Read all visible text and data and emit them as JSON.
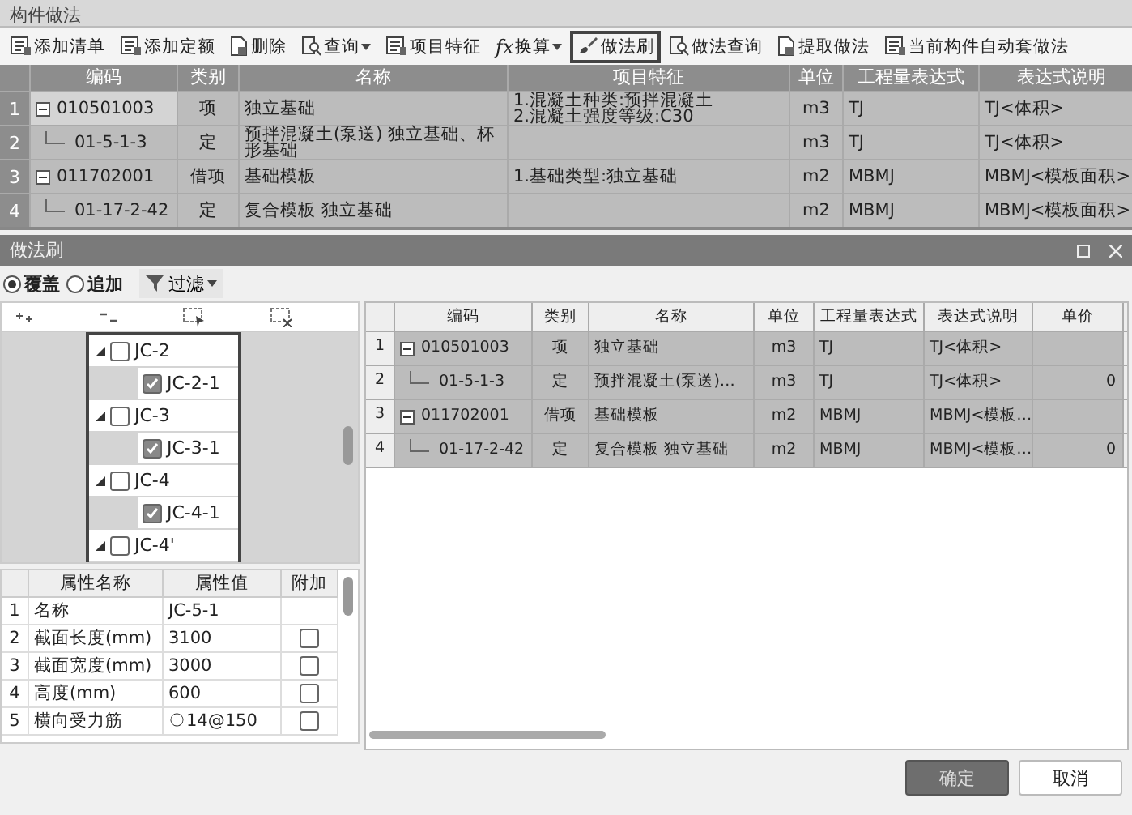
{
  "window": {
    "title": "构件做法"
  },
  "toolbar": [
    {
      "label": "添加清单",
      "kind": "list",
      "dropdown": false,
      "selected": false
    },
    {
      "label": "添加定额",
      "kind": "list",
      "dropdown": false,
      "selected": false
    },
    {
      "label": "删除",
      "kind": "doc",
      "dropdown": false,
      "selected": false
    },
    {
      "label": "查询",
      "kind": "search",
      "dropdown": true,
      "selected": false
    },
    {
      "label": "项目特征",
      "kind": "list",
      "dropdown": false,
      "selected": false
    },
    {
      "label": "换算",
      "kind": "formula",
      "glyph": "fx",
      "dropdown": true,
      "selected": false
    },
    {
      "label": "做法刷",
      "kind": "brush",
      "dropdown": false,
      "selected": true
    },
    {
      "label": "做法查询",
      "kind": "search",
      "dropdown": false,
      "selected": false
    },
    {
      "label": "提取做法",
      "kind": "doc",
      "dropdown": false,
      "selected": false
    },
    {
      "label": "当前构件自动套做法",
      "kind": "list",
      "dropdown": false,
      "selected": false
    }
  ],
  "top_table": {
    "columns": [
      "编码",
      "类别",
      "名称",
      "项目特征",
      "单位",
      "工程量表达式",
      "表达式说明"
    ],
    "rows": [
      {
        "num": "1",
        "kind": "parent",
        "expanded": true,
        "code": "010501003",
        "type": "项",
        "name": "独立基础",
        "feature": "1.混凝土种类:预拌混凝土\n2.混凝土强度等级:C30",
        "unit": "m3",
        "expr": "TJ",
        "desc": "TJ<体积>"
      },
      {
        "num": "2",
        "kind": "child",
        "code": "01-5-1-3",
        "type": "定",
        "name": "预拌混凝土(泵送) 独立基础、杯形基础",
        "feature": "",
        "unit": "m3",
        "expr": "TJ",
        "desc": "TJ<体积>"
      },
      {
        "num": "3",
        "kind": "parent",
        "expanded": true,
        "code": "011702001",
        "type": "借项",
        "name": "基础模板",
        "feature": "1.基础类型:独立基础",
        "unit": "m2",
        "expr": "MBMJ",
        "desc": "MBMJ<模板面积>"
      },
      {
        "num": "4",
        "kind": "child",
        "code": "01-17-2-42",
        "type": "定",
        "name": "复合模板 独立基础",
        "feature": "",
        "unit": "m2",
        "expr": "MBMJ",
        "desc": "MBMJ<模板面积>"
      }
    ]
  },
  "dialog": {
    "title": "做法刷",
    "modes": [
      {
        "label": "覆盖",
        "selected": true
      },
      {
        "label": "追加",
        "selected": false
      }
    ],
    "filter": {
      "label": "过滤"
    },
    "tree": [
      {
        "label": "JC-2",
        "expanded": true,
        "checked": false,
        "children": [
          {
            "label": "JC-2-1",
            "checked": true
          }
        ]
      },
      {
        "label": "JC-3",
        "expanded": true,
        "checked": false,
        "children": [
          {
            "label": "JC-3-1",
            "checked": true
          }
        ]
      },
      {
        "label": "JC-4",
        "expanded": true,
        "checked": false,
        "children": [
          {
            "label": "JC-4-1",
            "checked": true
          }
        ]
      },
      {
        "label": "JC-4'",
        "expanded": true,
        "checked": false
      }
    ],
    "properties": {
      "columns": [
        "属性名称",
        "属性值",
        "附加"
      ],
      "rows": [
        {
          "num": "1",
          "name": "名称",
          "value": "JC-5-1"
        },
        {
          "num": "2",
          "name": "截面长度(mm)",
          "value": "3100",
          "attached": false
        },
        {
          "num": "3",
          "name": "截面宽度(mm)",
          "value": "3000",
          "attached": false
        },
        {
          "num": "4",
          "name": "高度(mm)",
          "value": "600",
          "attached": false
        },
        {
          "num": "5",
          "name": "横向受力筋",
          "value": "⏀14@150",
          "attached": false
        }
      ]
    },
    "methods": {
      "columns": [
        "编码",
        "类别",
        "名称",
        "单位",
        "工程量表达式",
        "表达式说明",
        "单价"
      ],
      "rows": [
        {
          "num": "1",
          "kind": "parent",
          "expanded": true,
          "code": "010501003",
          "type": "项",
          "name": "独立基础",
          "unit": "m3",
          "expr": "TJ",
          "desc": "TJ<体积>",
          "price": ""
        },
        {
          "num": "2",
          "kind": "child",
          "code": "01-5-1-3",
          "type": "定",
          "name": "预拌混凝土(泵送)…",
          "unit": "m3",
          "expr": "TJ",
          "desc": "TJ<体积>",
          "price": "0"
        },
        {
          "num": "3",
          "kind": "parent",
          "expanded": true,
          "code": "011702001",
          "type": "借项",
          "name": "基础模板",
          "unit": "m2",
          "expr": "MBMJ",
          "desc": "MBMJ<模板…",
          "price": ""
        },
        {
          "num": "4",
          "kind": "child",
          "code": "01-17-2-42",
          "type": "定",
          "name": "复合模板 独立基础",
          "unit": "m2",
          "expr": "MBMJ",
          "desc": "MBMJ<模板…",
          "price": "0"
        }
      ]
    },
    "buttons": [
      {
        "label": "确定",
        "primary": true
      },
      {
        "label": "取消",
        "primary": false
      }
    ]
  }
}
